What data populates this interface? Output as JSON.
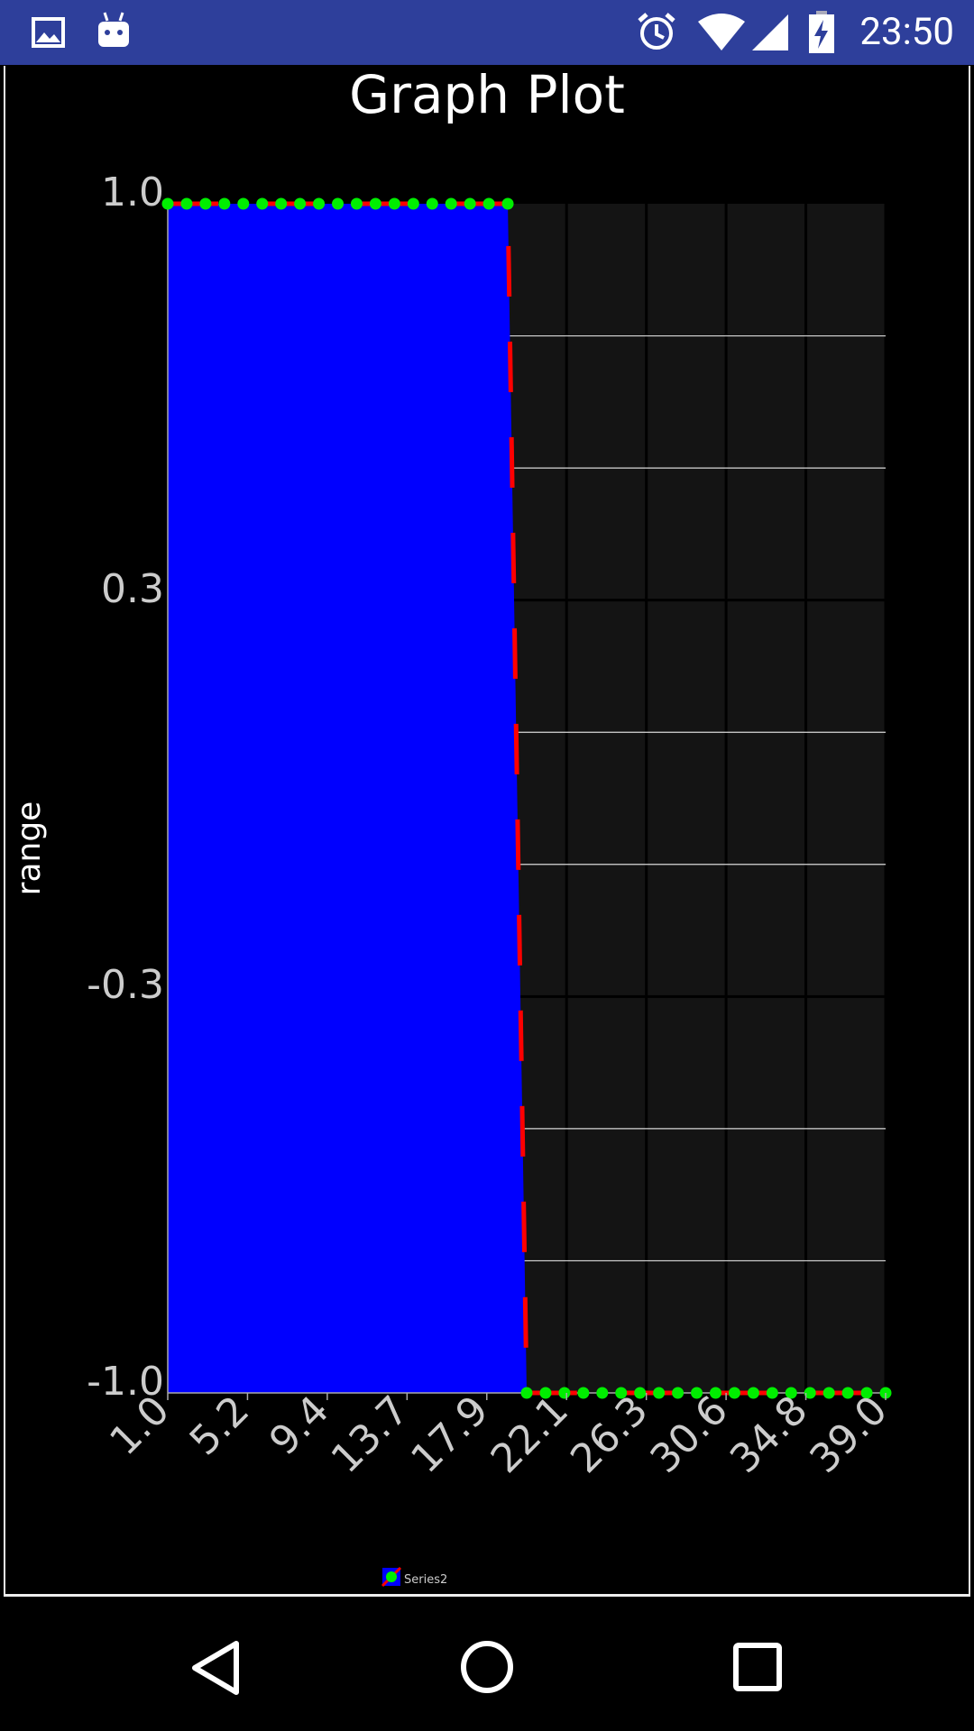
{
  "status_bar": {
    "time": "23:50",
    "icons": [
      "gallery-icon",
      "android-debug-icon",
      "alarm-icon",
      "wifi-icon",
      "signal-icon",
      "battery-charging-icon"
    ],
    "background": "#2e3f9b"
  },
  "nav_bar": {
    "buttons": [
      "back-icon",
      "home-icon",
      "recents-icon"
    ]
  },
  "chart_data": {
    "type": "area",
    "title": "Graph Plot",
    "xlabel": "",
    "ylabel": "range",
    "xlim": [
      1.0,
      39.0
    ],
    "ylim": [
      -1.0,
      1.0
    ],
    "x_ticks": [
      "1.0",
      "5.2",
      "9.4",
      "13.7",
      "17.9",
      "22.1",
      "26.3",
      "30.6",
      "34.8",
      "39.0"
    ],
    "y_ticks": [
      "1.0",
      "0.3",
      "-0.3",
      "-1.0"
    ],
    "y_tick_values": [
      1.0,
      0.333,
      -0.333,
      -1.0
    ],
    "grid": true,
    "legend_position": "bottom-left",
    "plot_background": "#141414",
    "series": [
      {
        "name": "Series2",
        "fill_color": "#0000ff",
        "line_color": "#ff0000",
        "line_style": "dashed",
        "marker_color": "#00ee00",
        "x": [
          1,
          2,
          3,
          4,
          5,
          6,
          7,
          8,
          9,
          10,
          11,
          12,
          13,
          14,
          15,
          16,
          17,
          18,
          19,
          20,
          21,
          22,
          23,
          24,
          25,
          26,
          27,
          28,
          29,
          30,
          31,
          32,
          33,
          34,
          35,
          36,
          37,
          38,
          39
        ],
        "y": [
          1,
          1,
          1,
          1,
          1,
          1,
          1,
          1,
          1,
          1,
          1,
          1,
          1,
          1,
          1,
          1,
          1,
          1,
          1,
          -1,
          -1,
          -1,
          -1,
          -1,
          -1,
          -1,
          -1,
          -1,
          -1,
          -1,
          -1,
          -1,
          -1,
          -1,
          -1,
          -1,
          -1,
          -1,
          -1
        ]
      }
    ]
  }
}
